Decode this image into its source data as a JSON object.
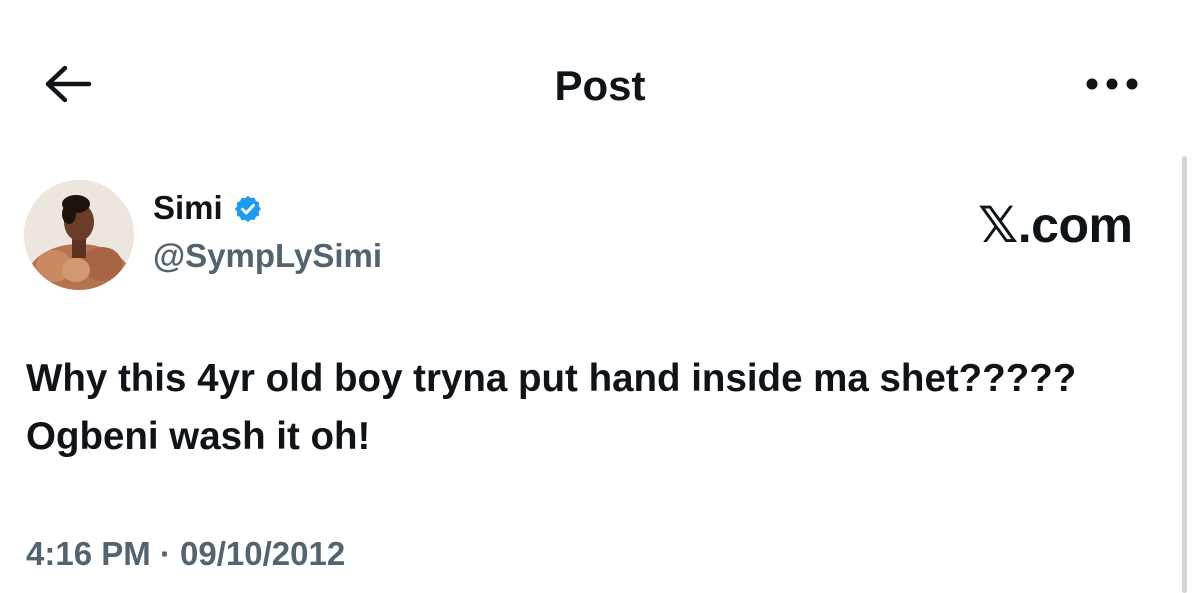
{
  "header": {
    "title": "Post",
    "back_icon": "arrow-left-icon",
    "more_icon": "more-horizontal-icon"
  },
  "author": {
    "name": "Simi",
    "handle": "@SympLySimi",
    "verified": true,
    "verified_color": "#1d9bf0"
  },
  "watermark": "𝕏.com",
  "post": {
    "text": "Why this 4yr old boy tryna put hand inside ma shet?????\nOgbeni wash it oh!",
    "timestamp": "4:16 PM · 09/10/2012"
  },
  "colors": {
    "text_primary": "#0f1419",
    "text_secondary": "#536471",
    "background": "#ffffff"
  }
}
